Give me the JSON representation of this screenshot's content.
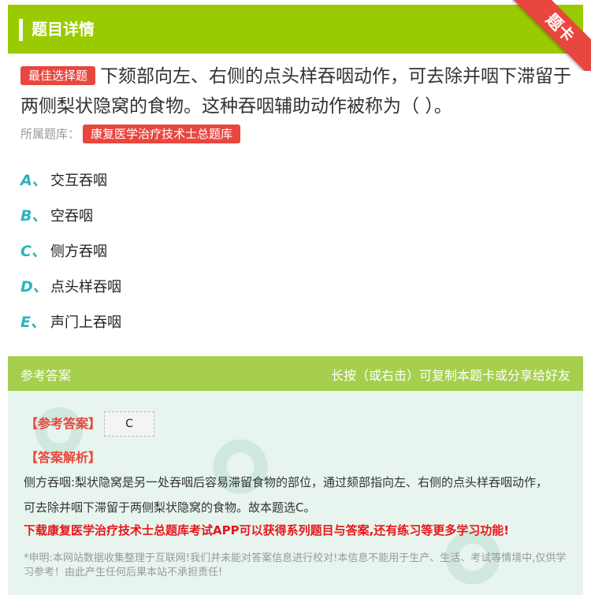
{
  "header": {
    "title": "题目详情",
    "ribbon_label": "题卡"
  },
  "question": {
    "tag": "最佳选择题",
    "text": "下颏部向左、右侧的点头样吞咽动作，可去除并咽下滞留于两侧梨状隐窝的食物。这种吞咽辅助动作被称为（ ）。",
    "bank_prefix": "所属题库：",
    "bank_name": "康复医学治疗技术士总题库"
  },
  "options": [
    {
      "letter": "A、",
      "text": "交互吞咽"
    },
    {
      "letter": "B、",
      "text": "空吞咽"
    },
    {
      "letter": "C、",
      "text": "侧方吞咽"
    },
    {
      "letter": "D、",
      "text": "点头样吞咽"
    },
    {
      "letter": "E、",
      "text": "声门上吞咽"
    }
  ],
  "answer": {
    "head_left": "参考答案",
    "head_right": "长按（或右击）可复制本题卡或分享给好友",
    "answer_label": "【参考答案】",
    "answer_value": "C",
    "explanation_label": "【答案解析】",
    "explanation": "侧方吞咽:梨状隐窝是另一处吞咽后容易滞留食物的部位，通过颏部指向左、右侧的点头样吞咽动作，可去除并咽下滞留于两侧梨状隐窝的食物。故本题选C。",
    "promo": "下载康复医学治疗技术士总题库考试APP可以获得系列题目与答案,还有练习等更多学习功能!",
    "disclaimer": "*申明:本网站数据收集整理于互联网!我们并未能对答案信息进行校对!本信息不能用于生产、生活、考试等情境中,仅供学习参考！由此产生任何后果本站不承担责任!"
  },
  "colors": {
    "green": "#9acb00",
    "red": "#e8473f",
    "teal": "#2bb3bd"
  }
}
